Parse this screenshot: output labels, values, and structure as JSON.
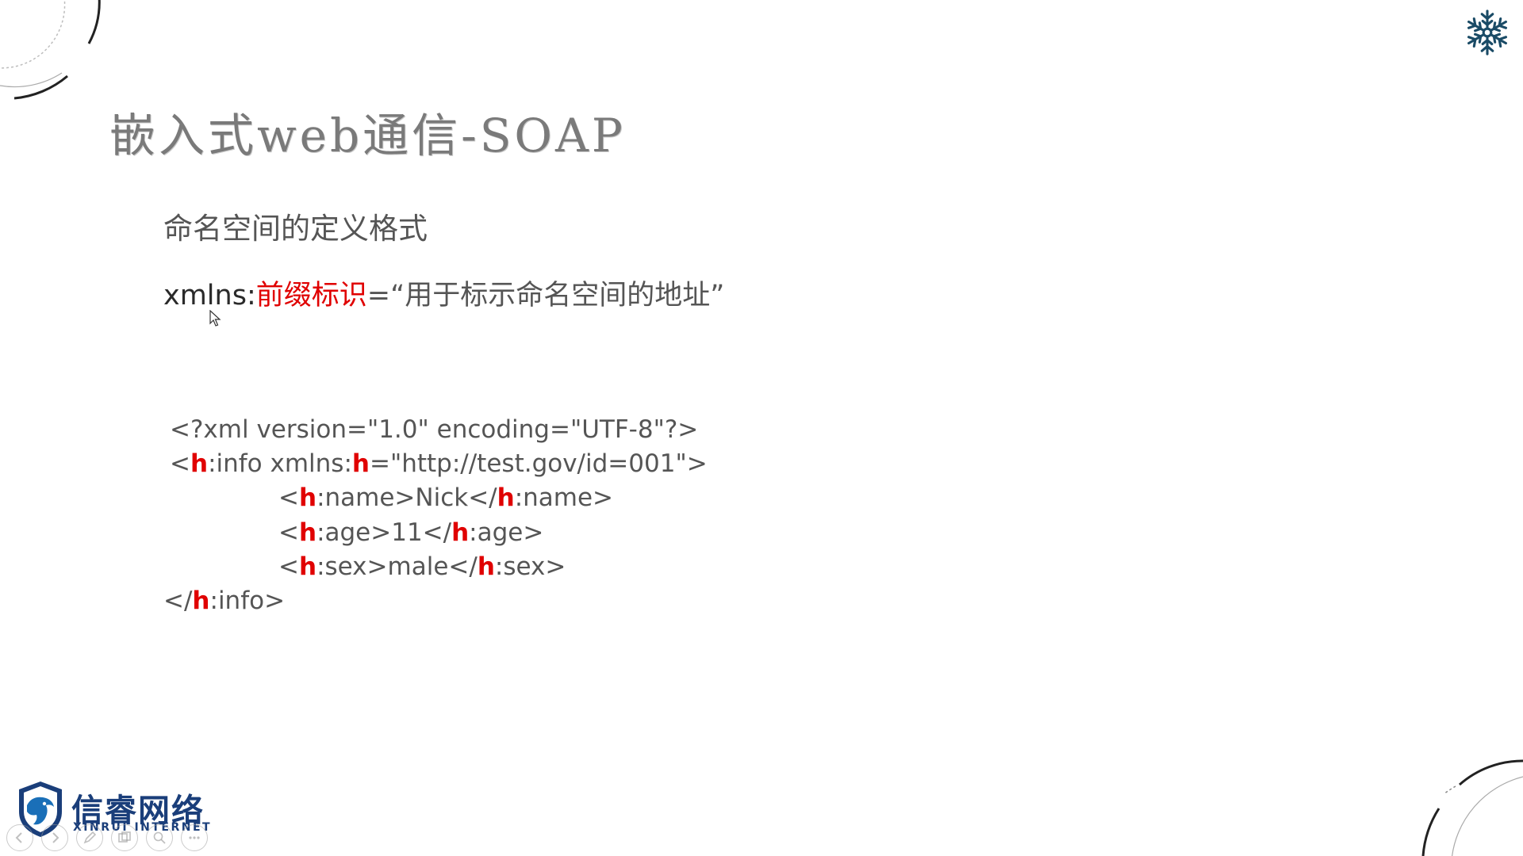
{
  "slide": {
    "title": "嵌入式web通信-SOAP",
    "subtitle": "命名空间的定义格式",
    "format_line": {
      "prefix": "xmlns:",
      "highlight": "前缀标识",
      "suffix": "=“用于标示命名空间的地址”"
    },
    "code_lines": [
      {
        "parts": [
          {
            "t": "<?xml version=\"1.0\" encoding=\"UTF-8\"?>"
          }
        ]
      },
      {
        "parts": [
          {
            "t": "<"
          },
          {
            "t": "h",
            "h": true
          },
          {
            "t": ":info xmlns:"
          },
          {
            "t": "h",
            "h": true
          },
          {
            "t": "=\"http://test.gov/id=001\">"
          }
        ]
      },
      {
        "parts": [
          {
            "t": "<"
          },
          {
            "t": "h",
            "h": true
          },
          {
            "t": ":name>Nick</"
          },
          {
            "t": "h",
            "h": true
          },
          {
            "t": ":name>"
          }
        ]
      },
      {
        "parts": [
          {
            "t": "<"
          },
          {
            "t": "h",
            "h": true
          },
          {
            "t": ":age>11</"
          },
          {
            "t": "h",
            "h": true
          },
          {
            "t": ":age>"
          }
        ]
      },
      {
        "parts": [
          {
            "t": "<"
          },
          {
            "t": "h",
            "h": true
          },
          {
            "t": ":sex>male</"
          },
          {
            "t": "h",
            "h": true
          },
          {
            "t": ":sex>"
          }
        ]
      },
      {
        "parts": [
          {
            "t": "</"
          },
          {
            "t": "h",
            "h": true
          },
          {
            "t": ":info>"
          }
        ]
      }
    ]
  },
  "logo": {
    "name_cn": "信睿网络",
    "name_en": "XINRUI INTERNET",
    "icon": "shield-logo-icon"
  },
  "navigation": {
    "buttons": [
      {
        "name": "previous-slide-button",
        "icon": "arrow-left-icon"
      },
      {
        "name": "next-slide-button",
        "icon": "arrow-right-icon"
      },
      {
        "name": "pen-tool-button",
        "icon": "pen-icon"
      },
      {
        "name": "slide-overview-button",
        "icon": "slides-icon"
      },
      {
        "name": "zoom-button",
        "icon": "magnifier-icon"
      },
      {
        "name": "more-options-button",
        "icon": "more-dots-icon"
      }
    ]
  },
  "colors": {
    "highlight": "#e00000",
    "text": "#555555",
    "title": "#7a7a7a",
    "logo": "#1a3e7a"
  }
}
